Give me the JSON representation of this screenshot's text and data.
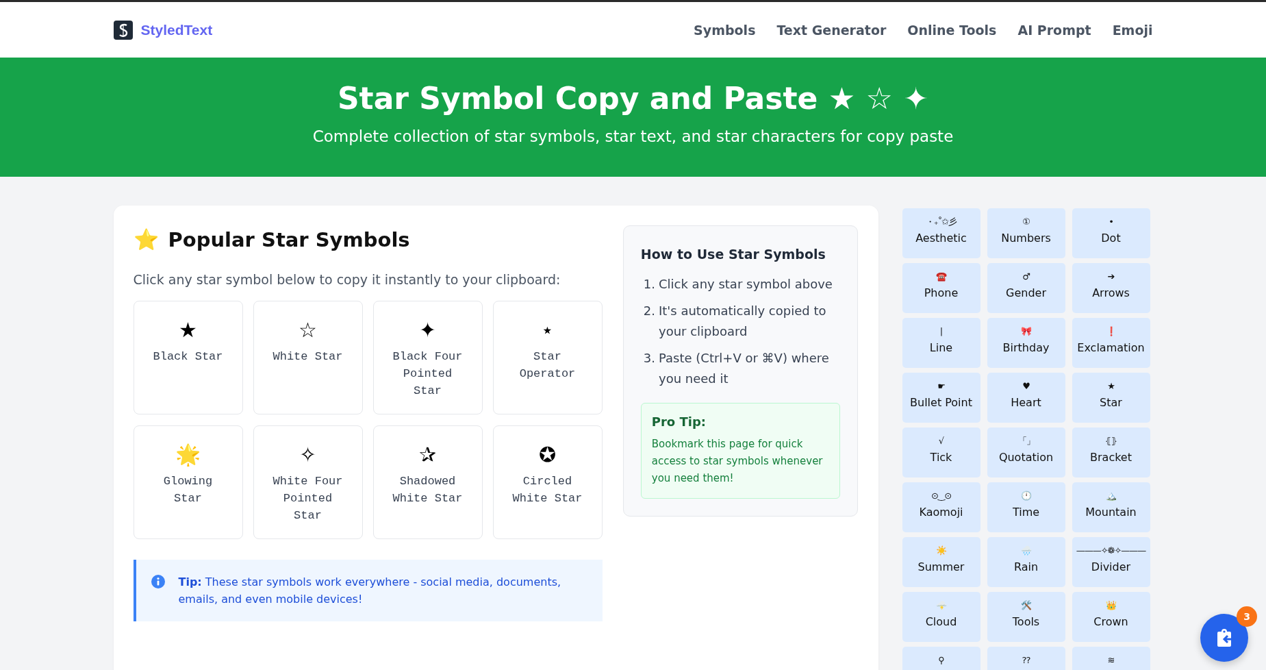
{
  "site": {
    "logo_text": "StyledText",
    "nav": [
      {
        "label": "Symbols"
      },
      {
        "label": "Text Generator"
      },
      {
        "label": "Online Tools"
      },
      {
        "label": "AI Prompt"
      },
      {
        "label": "Emoji"
      }
    ]
  },
  "hero": {
    "title": "Star Symbol Copy and Paste ★ ☆ ✦",
    "subtitle": "Complete collection of star symbols, star text, and star characters for copy paste"
  },
  "main": {
    "heading_icon": "⭐",
    "heading": "Popular Star Symbols",
    "intro": "Click any star symbol below to copy it instantly to your clipboard:",
    "symbols": [
      {
        "symbol": "★",
        "name": "Black Star"
      },
      {
        "symbol": "☆",
        "name": "White Star"
      },
      {
        "symbol": "✦",
        "name": "Black Four Pointed Star"
      },
      {
        "symbol": "⋆",
        "name": "Star Operator"
      },
      {
        "symbol": "🌟",
        "name": "Glowing Star"
      },
      {
        "symbol": "✧",
        "name": "White Four Pointed Star"
      },
      {
        "symbol": "✰",
        "name": "Shadowed White Star"
      },
      {
        "symbol": "✪",
        "name": "Circled White Star"
      }
    ],
    "tip": "**Tip:** These star symbols work everywhere - social media, documents, emails, and even mobile devices!"
  },
  "how_to": {
    "title": "How to Use Star Symbols",
    "steps": [
      {
        "number": "1.",
        "text": "Click any star symbol above"
      },
      {
        "number": "2.",
        "text": "It's automatically copied to your clipboard"
      },
      {
        "number": "3.",
        "text": "Paste (Ctrl+V or ⌘V) where you need it"
      }
    ],
    "pro_tip": {
      "title": "Pro Tip:",
      "text": "Bookmark this page for quick access to star symbols whenever you need them!"
    }
  },
  "categories": [
    {
      "symbol": "・₊˚✩彡",
      "label": "Aesthetic"
    },
    {
      "symbol": "①",
      "label": "Numbers"
    },
    {
      "symbol": "•",
      "label": "Dot"
    },
    {
      "symbol": "☎️",
      "label": "Phone"
    },
    {
      "symbol": "♂",
      "label": "Gender"
    },
    {
      "symbol": "➔",
      "label": "Arrows"
    },
    {
      "symbol": "|",
      "label": "Line"
    },
    {
      "symbol": "🎀",
      "label": "Birthday"
    },
    {
      "symbol": "❗",
      "label": "Exclamation"
    },
    {
      "symbol": "☛",
      "label": "Bullet Point"
    },
    {
      "symbol": "♥",
      "label": "Heart"
    },
    {
      "symbol": "★",
      "label": "Star"
    },
    {
      "symbol": "√",
      "label": "Tick"
    },
    {
      "symbol": "「」",
      "label": "Quotation"
    },
    {
      "symbol": "⦃⦄",
      "label": "Bracket"
    },
    {
      "symbol": "⊙‿⊙",
      "label": "Kaomoji"
    },
    {
      "symbol": "🕛",
      "label": "Time"
    },
    {
      "symbol": "🏔️",
      "label": "Mountain"
    },
    {
      "symbol": "☀️",
      "label": "Summer"
    },
    {
      "symbol": "🌧️",
      "label": "Rain"
    },
    {
      "symbol": "———✧❁✧———",
      "label": "Divider"
    },
    {
      "symbol": "🌩️",
      "label": "Cloud"
    },
    {
      "symbol": "🛠️",
      "label": "Tools"
    },
    {
      "symbol": "👑",
      "label": "Crown"
    },
    {
      "symbol": "⚲"
    },
    {
      "symbol": "??"
    },
    {
      "symbol": "≋"
    }
  ],
  "clipboard": {
    "count": "3"
  }
}
